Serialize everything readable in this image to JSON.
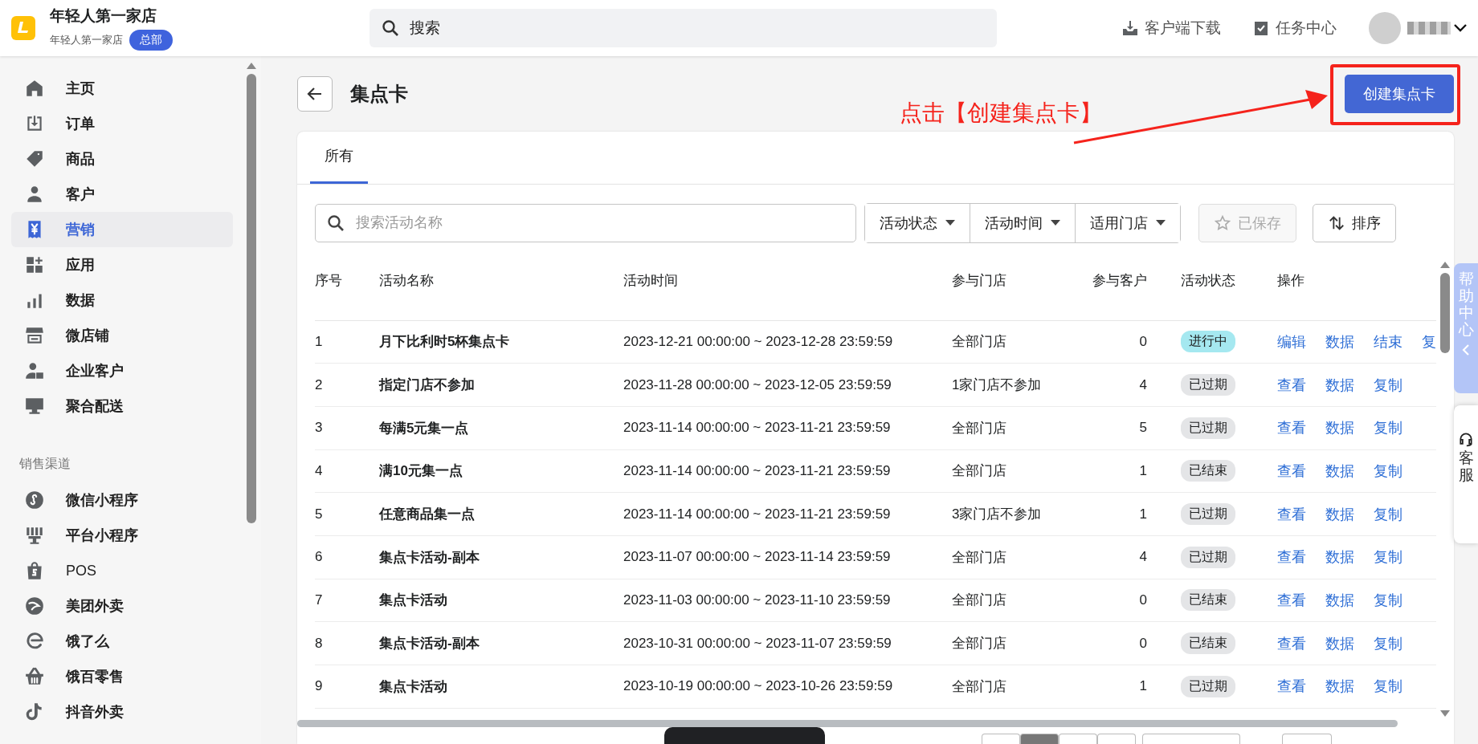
{
  "brand": {
    "store_name": "年轻人第一家店",
    "store_sub": "年轻人第一家店",
    "badge": "总部"
  },
  "search": {
    "placeholder": "搜索"
  },
  "top_actions": [
    {
      "label": "客户端下载",
      "kind": "download"
    },
    {
      "label": "任务中心",
      "kind": "task"
    }
  ],
  "sidebar": {
    "items": [
      {
        "label": "主页",
        "kind": "home",
        "selected": false
      },
      {
        "label": "订单",
        "kind": "order",
        "selected": false
      },
      {
        "label": "商品",
        "kind": "tag",
        "selected": false
      },
      {
        "label": "客户",
        "kind": "user",
        "selected": false
      },
      {
        "label": "营销",
        "kind": "yen",
        "selected": true
      },
      {
        "label": "应用",
        "kind": "apps",
        "selected": false
      },
      {
        "label": "数据",
        "kind": "chart",
        "selected": false
      },
      {
        "label": "微店铺",
        "kind": "store",
        "selected": false
      },
      {
        "label": "企业客户",
        "kind": "enterprise",
        "selected": false
      },
      {
        "label": "聚合配送",
        "kind": "monitor",
        "selected": false
      }
    ],
    "section_title": "销售渠道",
    "channels": [
      {
        "label": "微信小程序",
        "kind": "miniapp",
        "selected": false
      },
      {
        "label": "平台小程序",
        "kind": "platform",
        "selected": false
      },
      {
        "label": "POS",
        "kind": "bag",
        "selected": false
      },
      {
        "label": "美团外卖",
        "kind": "meituan",
        "selected": false
      },
      {
        "label": "饿了么",
        "kind": "eleme",
        "selected": false
      },
      {
        "label": "饿百零售",
        "kind": "basket",
        "selected": false
      },
      {
        "label": "抖音外卖",
        "kind": "tiktok",
        "selected": false
      }
    ]
  },
  "page": {
    "title": "集点卡",
    "create_button": "创建集点卡",
    "annotation": "点击【创建集点卡】"
  },
  "tabs": [
    {
      "label": "所有",
      "selected": true
    }
  ],
  "filters": {
    "search_placeholder": "搜索活动名称",
    "dropdowns": [
      "活动状态",
      "活动时间",
      "适用门店"
    ],
    "saved": {
      "label": "已保存",
      "disabled": true
    },
    "sort": "排序"
  },
  "table": {
    "columns": [
      "序号",
      "活动名称",
      "活动时间",
      "参与门店",
      "参与客户",
      "活动状态",
      "操作"
    ],
    "rows": [
      {
        "index": "1",
        "name": "月下比利时5杯集点卡",
        "time": "2023-12-21 00:00:00 ~ 2023-12-28 23:59:59",
        "stores": "全部门店",
        "customers": "0",
        "status": {
          "label": "进行中",
          "kind": "active"
        },
        "actions": [
          "编辑",
          "数据",
          "结束",
          "复"
        ]
      },
      {
        "index": "2",
        "name": "指定门店不参加",
        "time": "2023-11-28 00:00:00 ~ 2023-12-05 23:59:59",
        "stores": "1家门店不参加",
        "customers": "4",
        "status": {
          "label": "已过期",
          "kind": "expired"
        },
        "actions": [
          "查看",
          "数据",
          "复制"
        ]
      },
      {
        "index": "3",
        "name": "每满5元集一点",
        "time": "2023-11-14 00:00:00 ~ 2023-11-21 23:59:59",
        "stores": "全部门店",
        "customers": "5",
        "status": {
          "label": "已过期",
          "kind": "expired"
        },
        "actions": [
          "查看",
          "数据",
          "复制"
        ]
      },
      {
        "index": "4",
        "name": "满10元集一点",
        "time": "2023-11-14 00:00:00 ~ 2023-11-21 23:59:59",
        "stores": "全部门店",
        "customers": "1",
        "status": {
          "label": "已结束",
          "kind": "ended"
        },
        "actions": [
          "查看",
          "数据",
          "复制"
        ]
      },
      {
        "index": "5",
        "name": "任意商品集一点",
        "time": "2023-11-14 00:00:00 ~ 2023-11-21 23:59:59",
        "stores": "3家门店不参加",
        "customers": "1",
        "status": {
          "label": "已过期",
          "kind": "expired"
        },
        "actions": [
          "查看",
          "数据",
          "复制"
        ]
      },
      {
        "index": "6",
        "name": "集点卡活动-副本",
        "time": "2023-11-07 00:00:00 ~ 2023-11-14 23:59:59",
        "stores": "全部门店",
        "customers": "4",
        "status": {
          "label": "已过期",
          "kind": "expired"
        },
        "actions": [
          "查看",
          "数据",
          "复制"
        ]
      },
      {
        "index": "7",
        "name": "集点卡活动",
        "time": "2023-11-03 00:00:00 ~ 2023-11-10 23:59:59",
        "stores": "全部门店",
        "customers": "0",
        "status": {
          "label": "已结束",
          "kind": "ended"
        },
        "actions": [
          "查看",
          "数据",
          "复制"
        ]
      },
      {
        "index": "8",
        "name": "集点卡活动-副本",
        "time": "2023-10-31 00:00:00 ~ 2023-11-07 23:59:59",
        "stores": "全部门店",
        "customers": "0",
        "status": {
          "label": "已结束",
          "kind": "ended"
        },
        "actions": [
          "查看",
          "数据",
          "复制"
        ]
      },
      {
        "index": "9",
        "name": "集点卡活动",
        "time": "2023-10-19 00:00:00 ~ 2023-10-26 23:59:59",
        "stores": "全部门店",
        "customers": "1",
        "status": {
          "label": "已过期",
          "kind": "expired"
        },
        "actions": [
          "查看",
          "数据",
          "复制"
        ]
      }
    ]
  },
  "pagination": [
    {
      "selected": false
    },
    {
      "selected": true
    },
    {
      "selected": false
    },
    {
      "selected": false
    }
  ],
  "help": {
    "help_center": "帮助中心",
    "service": "客服"
  }
}
